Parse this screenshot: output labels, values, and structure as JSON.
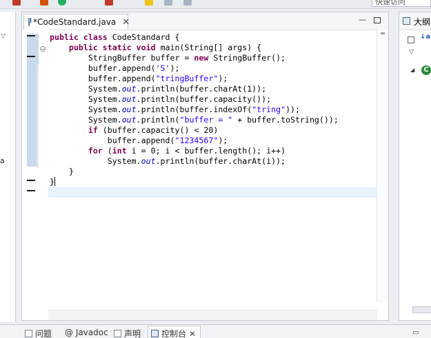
{
  "toolbar": {
    "search_text": "快速访问",
    "icons": [
      "debug-icon",
      "run-icon",
      "tools-icon",
      "open-perspective-icon",
      "java-perspective-icon",
      "layout-icon",
      "view-icon"
    ]
  },
  "left_panel": {
    "fragment_text": "a"
  },
  "editor": {
    "tab_label": "*CodeStandard.java",
    "tab_close": "✕",
    "minimize_label": "—",
    "code_lines": [
      [
        {
          "t": "kw",
          "v": "public"
        },
        {
          "t": "",
          "v": " "
        },
        {
          "t": "kw",
          "v": "class"
        },
        {
          "t": "",
          "v": " CodeStandard {"
        }
      ],
      [
        {
          "t": "",
          "v": "    "
        },
        {
          "t": "kw",
          "v": "public"
        },
        {
          "t": "",
          "v": " "
        },
        {
          "t": "kw",
          "v": "static"
        },
        {
          "t": "",
          "v": " "
        },
        {
          "t": "kw",
          "v": "void"
        },
        {
          "t": "",
          "v": " main(String[] args) {"
        }
      ],
      [
        {
          "t": "",
          "v": "        StringBuffer buffer = "
        },
        {
          "t": "kw",
          "v": "new"
        },
        {
          "t": "",
          "v": " StringBuffer();"
        }
      ],
      [
        {
          "t": "",
          "v": "        buffer.append("
        },
        {
          "t": "str",
          "v": "'S'"
        },
        {
          "t": "",
          "v": ");"
        }
      ],
      [
        {
          "t": "",
          "v": "        buffer.append("
        },
        {
          "t": "str",
          "v": "\"tringBuffer\""
        },
        {
          "t": "",
          "v": ");"
        }
      ],
      [
        {
          "t": "",
          "v": "        System."
        },
        {
          "t": "fld",
          "v": "out"
        },
        {
          "t": "",
          "v": ".println(buffer.charAt(1));"
        }
      ],
      [
        {
          "t": "",
          "v": "        System."
        },
        {
          "t": "fld",
          "v": "out"
        },
        {
          "t": "",
          "v": ".println(buffer.capacity());"
        }
      ],
      [
        {
          "t": "",
          "v": "        System."
        },
        {
          "t": "fld",
          "v": "out"
        },
        {
          "t": "",
          "v": ".println(buffer.indexOf("
        },
        {
          "t": "str",
          "v": "\"tring\""
        },
        {
          "t": "",
          "v": "));"
        }
      ],
      [
        {
          "t": "",
          "v": "        System."
        },
        {
          "t": "fld",
          "v": "out"
        },
        {
          "t": "",
          "v": ".println("
        },
        {
          "t": "str",
          "v": "\"buffer = \""
        },
        {
          "t": "",
          "v": " + buffer.toString());"
        }
      ],
      [
        {
          "t": "",
          "v": "        "
        },
        {
          "t": "kw",
          "v": "if"
        },
        {
          "t": "",
          "v": " (buffer.capacity() < 20)"
        }
      ],
      [
        {
          "t": "",
          "v": "            buffer.append("
        },
        {
          "t": "str",
          "v": "\"1234567\""
        },
        {
          "t": "",
          "v": ");"
        }
      ],
      [
        {
          "t": "",
          "v": "        "
        },
        {
          "t": "kw",
          "v": "for"
        },
        {
          "t": "",
          "v": " ("
        },
        {
          "t": "kw",
          "v": "int"
        },
        {
          "t": "",
          "v": " i = 0; i < buffer.length(); i++)"
        }
      ],
      [
        {
          "t": "",
          "v": "            System."
        },
        {
          "t": "fld",
          "v": "out"
        },
        {
          "t": "",
          "v": ".println(buffer.charAt(i));"
        }
      ],
      [
        {
          "t": "",
          "v": "    }"
        }
      ],
      [
        {
          "t": "",
          "v": "}"
        }
      ]
    ]
  },
  "outline": {
    "title": "大纲",
    "class_icon_letter": "C"
  },
  "bottom_panel": {
    "tabs": [
      {
        "label": "问题"
      },
      {
        "label": "@ Javadoc"
      },
      {
        "label": "声明"
      },
      {
        "label": "控制台",
        "active": true
      }
    ],
    "close_glyph": "✕"
  },
  "colors": {
    "keyword": "#7f0055",
    "string": "#2a00ff",
    "field": "#0000c0",
    "current_line": "#e8f2fe"
  }
}
